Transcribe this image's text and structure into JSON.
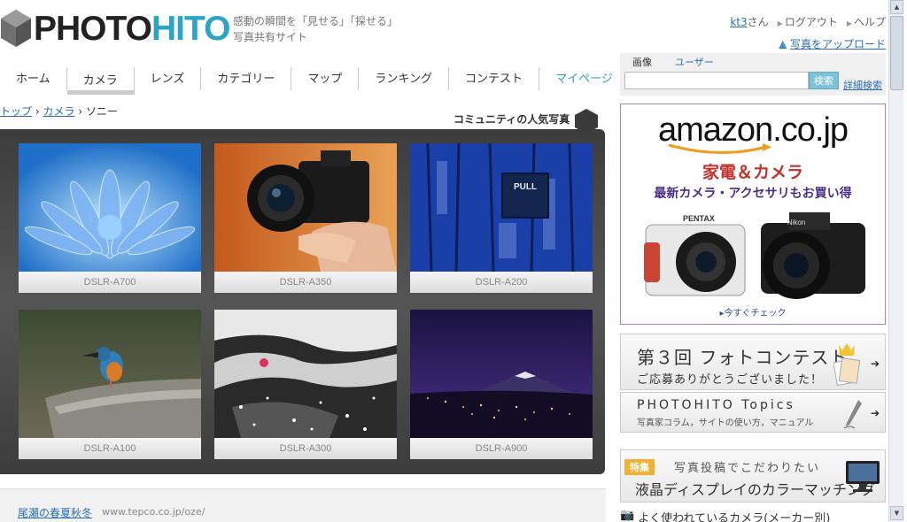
{
  "logo": {
    "photo": "PHOTO",
    "hito": "HITO"
  },
  "tagline": {
    "line1": "感動の瞬間を「見せる」「探せる」",
    "line2": "写真共有サイト"
  },
  "user_links": {
    "username": "kt3",
    "san": "さん",
    "logout": "ログアウト",
    "help": "ヘルプ"
  },
  "upload_label": "写真をアップロード",
  "nav": [
    {
      "label": "ホーム"
    },
    {
      "label": "カメラ"
    },
    {
      "label": "レンズ"
    },
    {
      "label": "カテゴリー"
    },
    {
      "label": "マップ"
    },
    {
      "label": "ランキング"
    },
    {
      "label": "コンテスト"
    },
    {
      "label": "マイページ"
    }
  ],
  "breadcrumb": {
    "top": "トップ",
    "camera": "カメラ",
    "current": "ソニー",
    "sep": "›"
  },
  "community_title": "コミュニティの人気写真",
  "photos": [
    {
      "caption": "DSLR-A700",
      "subject": "blue-lotus-flower"
    },
    {
      "caption": "DSLR-A350",
      "subject": "hand-holding-camera"
    },
    {
      "caption": "DSLR-A200",
      "subject": "blue-door-pull-sign"
    },
    {
      "caption": "DSLR-A100",
      "subject": "kingfisher-on-rock"
    },
    {
      "caption": "DSLR-A300",
      "subject": "snowy-branches"
    },
    {
      "caption": "DSLR-A900",
      "subject": "mount-fuji-night"
    }
  ],
  "pull_sign": "PULL",
  "ad_bottom": {
    "link": "尾瀬の春夏秋冬",
    "url": "www.tepco.co.jp/oze/"
  },
  "search": {
    "tab_image": "画像",
    "tab_user": "ユーザー",
    "button": "検索",
    "advanced": "詳細検索",
    "value": ""
  },
  "amazon": {
    "logo": "amazon.co.jp",
    "headline": "家電＆カメラ",
    "sub": "最新カメラ・アクセサリもお買い得",
    "check": "今すぐチェック",
    "brand_left": "PENTAX",
    "brand_right": "Nikon"
  },
  "contest": {
    "title": "第３回 フォトコンテスト",
    "sub": "ご応募ありがとうございました！"
  },
  "topics": {
    "title": "PHOTOHITO Topics",
    "sub": "写真家コラム，サイトの使い方，マニュアル"
  },
  "special": {
    "tag": "特集",
    "line1": "写真投稿でこだわりたい",
    "line2": "液晶ディスプレイのカラーマッチング"
  },
  "popular_cameras": "よく使われているカメラ(メーカー別)",
  "colors": {
    "accent": "#2aa5c8",
    "link": "#2a6eb8",
    "panel": "#474747",
    "amazon_border": "#a386b5"
  }
}
